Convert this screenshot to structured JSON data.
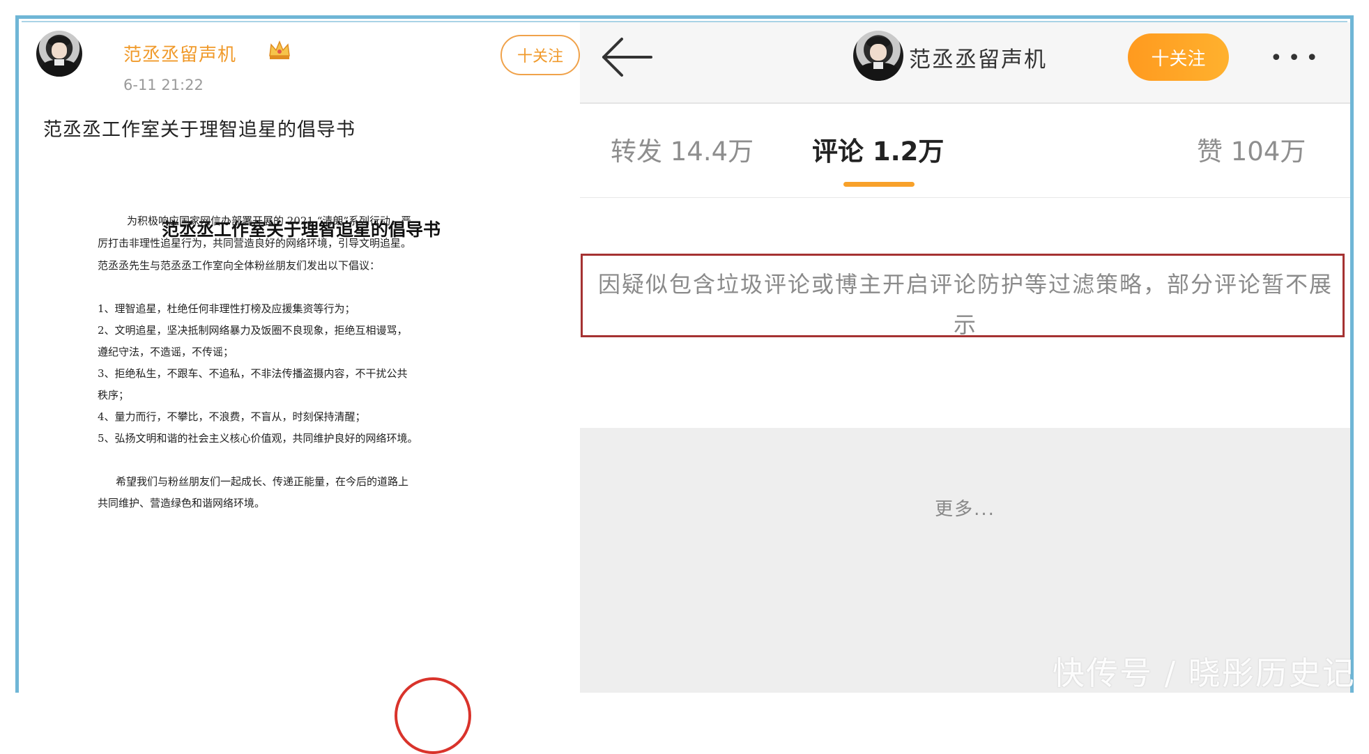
{
  "left_panel": {
    "author_name": "范丞丞留声机",
    "timestamp": "6-11 21:22",
    "follow_label": "十关注",
    "post_text": "范丞丞工作室关于理智追星的倡导书",
    "document": {
      "title": "范丞丞工作室关于理智追星的倡导书",
      "lines": [
        "为积极响应国家网信办部署开展的 2021 “清朗”系列行动，严",
        "厉打击非理性追星行为，共同营造良好的网络环境，引导文明追星。",
        "范丞丞先生与范丞丞工作室向全体粉丝朋友们发出以下倡议：",
        "1、理智追星，杜绝任何非理性打榜及应援集资等行为；",
        "2、文明追星，坚决抵制网络暴力及饭圈不良现象，拒绝互相谩骂，",
        "遵纪守法，不造谣，不传谣；",
        "3、拒绝私生，不跟车、不追私，不非法传播盗摄内容，不干扰公共",
        "秩序；",
        "4、量力而行，不攀比，不浪费，不盲从，时刻保持清醒；",
        "5、弘扬文明和谐的社会主义核心价值观，共同维护良好的网络环境。",
        "希望我们与粉丝朋友们一起成长、传递正能量，在今后的道路上",
        "共同维护、营造绿色和谐网络环境。"
      ]
    }
  },
  "right_panel": {
    "author_name": "范丞丞留声机",
    "follow_label": "十关注",
    "more_menu": "•••",
    "tabs": [
      {
        "label": "转发 14.4万"
      },
      {
        "label": "评论 1.2万"
      },
      {
        "label": "赞 104万"
      }
    ],
    "notice": "因疑似包含垃圾评论或博主开启评论防护等过滤策略，部分评论暂不展示",
    "more_label": "更多..."
  },
  "watermark": "快传号 / 晓彤历史记",
  "colors": {
    "accent_orange": "#f8a12a",
    "frame_blue": "#6fb6d6",
    "notice_border": "#a53232"
  }
}
